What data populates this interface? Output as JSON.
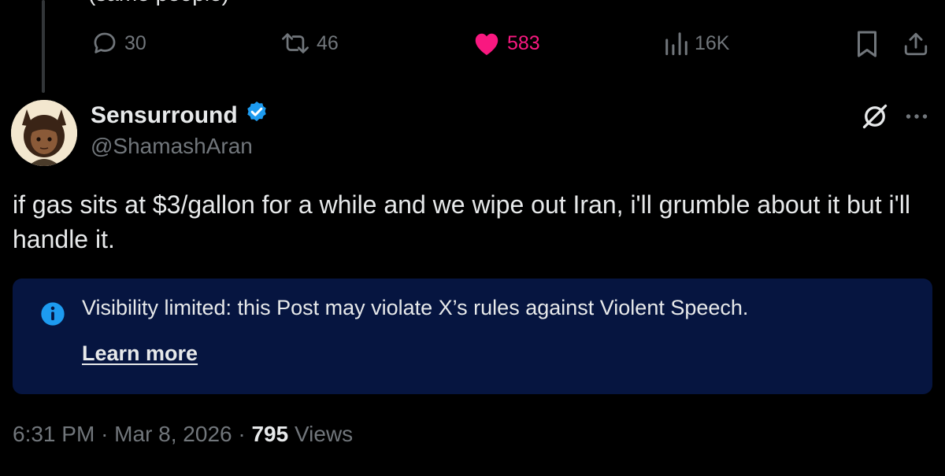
{
  "previous_post": {
    "cropped_text": "(same people)"
  },
  "actions": {
    "replies": "30",
    "reposts": "46",
    "likes": "583",
    "views": "16K"
  },
  "post": {
    "author_name": "Sensurround",
    "author_handle": "@ShamashAran",
    "verified": true,
    "text": "if gas sits at $3/gallon for a while and we wipe out Iran, i'll grumble about it but i'll handle it."
  },
  "notice": {
    "message": "Visibility limited: this Post may violate X’s rules against Violent Speech.",
    "link_label": "Learn more"
  },
  "meta": {
    "time": "6:31 PM",
    "separator": "·",
    "date": "Mar 8, 2026",
    "views_count": "795",
    "views_label": "Views"
  },
  "colors": {
    "background": "#000000",
    "text_primary": "#e7e9ea",
    "text_secondary": "#71767b",
    "like_pink": "#f91880",
    "verified_blue": "#1d9bf0",
    "notice_background": "#061540"
  }
}
